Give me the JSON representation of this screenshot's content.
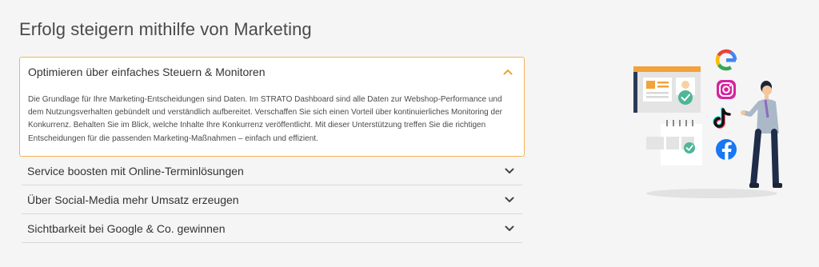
{
  "page": {
    "title": "Erfolg steigern mithilfe von Marketing"
  },
  "accordion": {
    "items": [
      {
        "title": "Optimieren über einfaches Steuern & Monitoren",
        "state": "expanded",
        "icon": "chevron-up-icon",
        "body": "Die Grundlage für Ihre Marketing-Entscheidungen sind Daten. Im STRATO Dashboard sind alle Daten zur Webshop-Performance und dem Nutzungsverhalten gebündelt und verständlich aufbereitet. Verschaffen Sie sich einen Vorteil über kontinuierliches Monitoring der Konkurrenz. Behalten Sie im Blick, welche Inhalte Ihre Konkurrenz veröffentlicht. Mit dieser Unterstützung treffen Sie die richtigen Entscheidungen für die passenden Marketing-Maßnahmen – einfach und effizient."
      },
      {
        "title": "Service boosten mit Online-Terminlösungen",
        "state": "collapsed",
        "icon": "chevron-down-icon"
      },
      {
        "title": "Über Social-Media mehr Umsatz erzeugen",
        "state": "collapsed",
        "icon": "chevron-down-icon"
      },
      {
        "title": "Sichtbarkeit bei Google & Co. gewinnen",
        "state": "collapsed",
        "icon": "chevron-down-icon"
      }
    ]
  },
  "illustration": {
    "icons": [
      "google-icon",
      "instagram-icon",
      "tiktok-icon",
      "facebook-icon",
      "dashboard-icon",
      "calendar-icon",
      "person-icon"
    ]
  },
  "colors": {
    "accent": "#f5b25c",
    "chevron_open": "#e8a33d",
    "chevron_closed": "#444444",
    "background": "#f5f5f5"
  }
}
